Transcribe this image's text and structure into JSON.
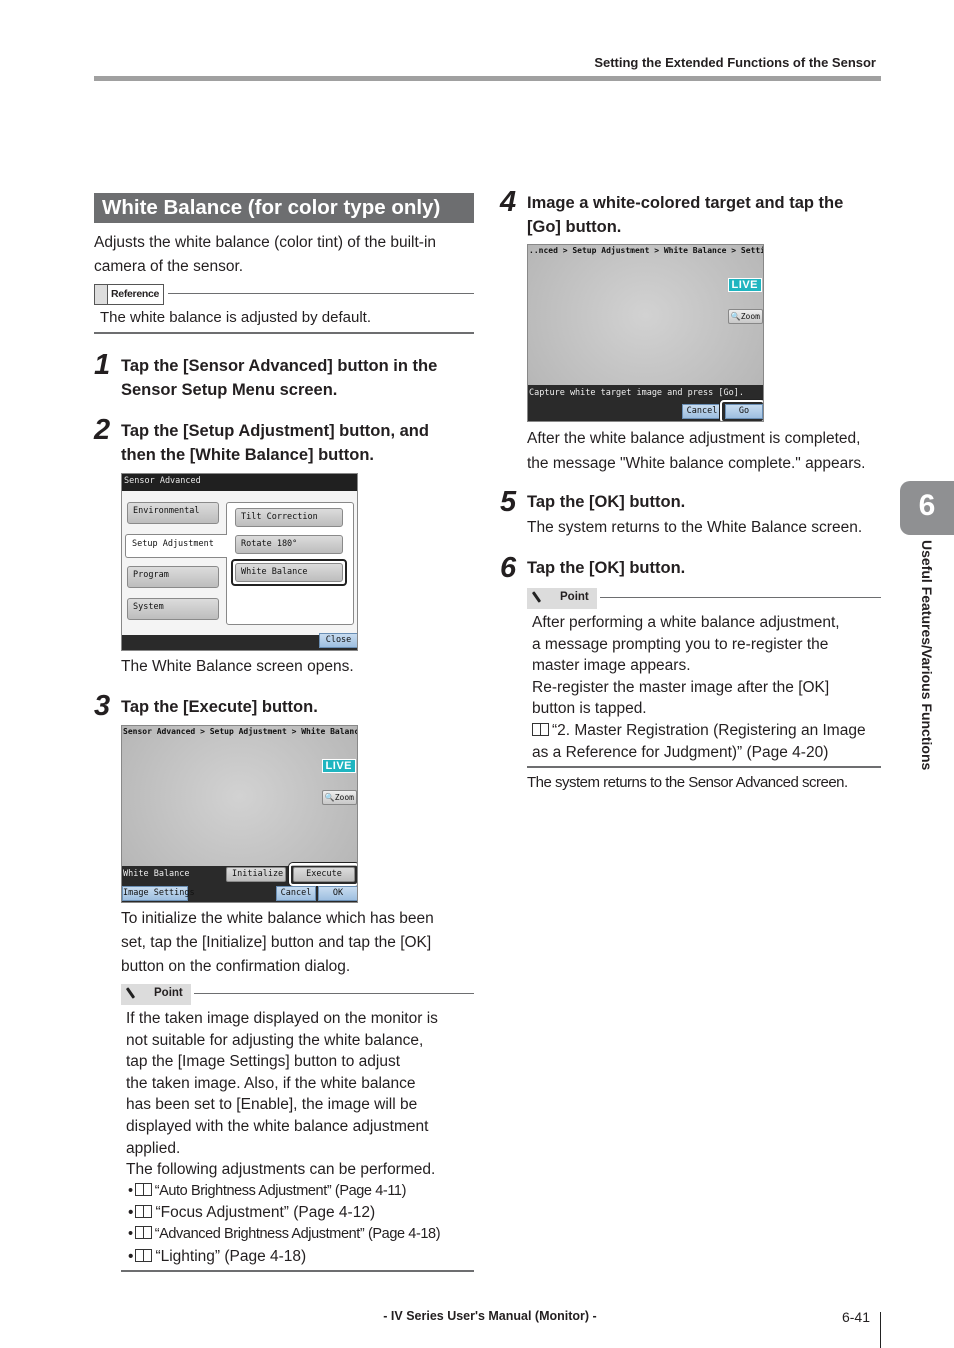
{
  "header": {
    "title": "Setting the Extended Functions of the Sensor"
  },
  "section": {
    "title": "White Balance (for color type only)",
    "intro": [
      "Adjusts the white balance (color tint) of the built-in",
      "camera of the sensor."
    ],
    "reference": {
      "label": "Reference",
      "text": "The white balance is adjusted by default."
    }
  },
  "steps": [
    {
      "num": "1",
      "lines": [
        "Tap the [Sensor Advanced] button in the",
        "Sensor Setup Menu screen."
      ]
    },
    {
      "num": "2",
      "lines": [
        "Tap the [Setup Adjustment] button, and",
        "then the [White Balance] button."
      ],
      "caption": "The White Balance screen opens."
    },
    {
      "num": "3",
      "lines": [
        "Tap the [Execute] button."
      ],
      "after": [
        "To initialize the white balance which has been",
        "set, tap the [Initialize] button and tap the [OK]",
        "button on the confirmation dialog."
      ]
    },
    {
      "num": "4",
      "lines": [
        "Image a white-colored target and tap the",
        "[Go] button."
      ],
      "after": [
        "After the white balance adjustment is completed,",
        "the message \"White balance complete.\" appears."
      ]
    },
    {
      "num": "5",
      "lines": [
        "Tap the [OK] button."
      ],
      "after": [
        "The system returns to the White Balance screen."
      ]
    },
    {
      "num": "6",
      "lines": [
        "Tap the [OK] button."
      ],
      "after": [
        "The system returns to the Sensor Advanced screen."
      ]
    }
  ],
  "point1": {
    "label": "Point",
    "lines": [
      "If the taken image displayed on the monitor is",
      "not suitable for adjusting the white balance,",
      "tap the [Image Settings] button to adjust",
      "the taken image. Also, if the white balance",
      "has been set to [Enable], the image will be",
      "displayed with the white balance adjustment",
      "applied.",
      "The following adjustments can be performed."
    ],
    "refs": [
      "“Auto Brightness Adjustment” (Page 4-11)",
      "“Focus Adjustment” (Page 4-12)",
      "“Advanced Brightness Adjustment” (Page 4-18)",
      "“Lighting” (Page 4-18)"
    ]
  },
  "point2": {
    "label": "Point",
    "lines": [
      "After performing a white balance adjustment,",
      "a message prompting you to re-register the",
      "master image appears.",
      "Re-register the master image after the [OK]",
      "button is tapped."
    ],
    "ref": [
      "“2. Master Registration (Registering an Image",
      "as a Reference for Judgment)” (Page 4-20)"
    ]
  },
  "screen1": {
    "title": "Sensor Advanced",
    "tabs": [
      "Environmental",
      "Setup Adjustment",
      "Program",
      "System"
    ],
    "buttons": [
      "Tilt Correction",
      "Rotate 180°",
      "White Balance"
    ],
    "close": "Close"
  },
  "screen2": {
    "breadcrumb": "Sensor Advanced > Setup Adjustment > White Balance",
    "live": "LIVE",
    "zoom": "Zoom",
    "label": "White Balance",
    "initialize": "Initialize",
    "execute": "Execute",
    "image_settings": "Image Settings",
    "cancel": "Cancel",
    "ok": "OK"
  },
  "screen3": {
    "breadcrumb": "..nced > Setup Adjustment > White Balance > Settings",
    "live": "LIVE",
    "zoom": "Zoom",
    "message": "Capture white target image and press [Go].",
    "cancel": "Cancel",
    "go": "Go"
  },
  "chapter": {
    "number": "6",
    "title": "Useful Features/Various Functions"
  },
  "footer": {
    "manual": "- IV Series User's Manual (Monitor) -",
    "page": "6-41"
  }
}
